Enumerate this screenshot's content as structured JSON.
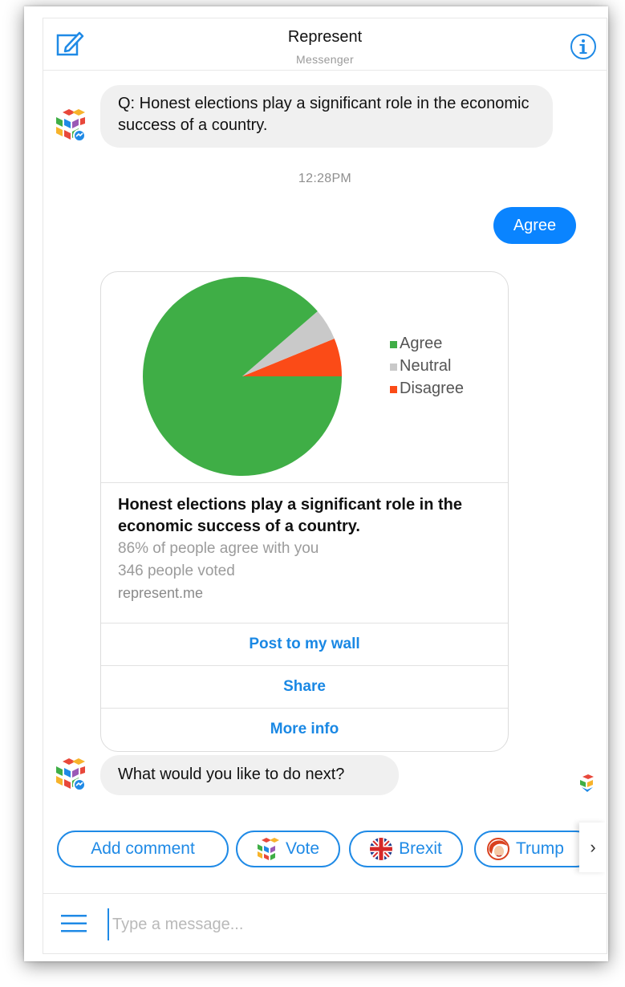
{
  "header": {
    "title": "Represent",
    "subtitle": "Messenger"
  },
  "messages": {
    "question": "Q: Honest elections play a significant role in the economic success of a country.",
    "timestamp": "12:28PM",
    "user_reply": "Agree",
    "next_prompt": "What would you like to do next?"
  },
  "card": {
    "title": "Honest elections play a significant role in the economic success of a country.",
    "agree_text": "86% of people agree with you",
    "voted_text": "346 people voted",
    "domain": "represent.me",
    "buttons": [
      "Post to my wall",
      "Share",
      "More info"
    ]
  },
  "chart_data": {
    "type": "pie",
    "categories": [
      "Agree",
      "Neutral",
      "Disagree"
    ],
    "values": [
      86,
      5,
      6
    ],
    "colors": [
      "#3fae46",
      "#c9c9c9",
      "#fb4b17"
    ],
    "legend_position": "right"
  },
  "quick_replies": [
    {
      "label": "Add comment",
      "icon": ""
    },
    {
      "label": "Vote",
      "icon": "cube-logo-icon"
    },
    {
      "label": "Brexit",
      "icon": "union-jack-icon"
    },
    {
      "label": "Trump",
      "icon": "trump-face-icon"
    }
  ],
  "composer": {
    "placeholder": "Type a message..."
  },
  "colors": {
    "accent": "#0a84ff",
    "link": "#1a88e4"
  }
}
